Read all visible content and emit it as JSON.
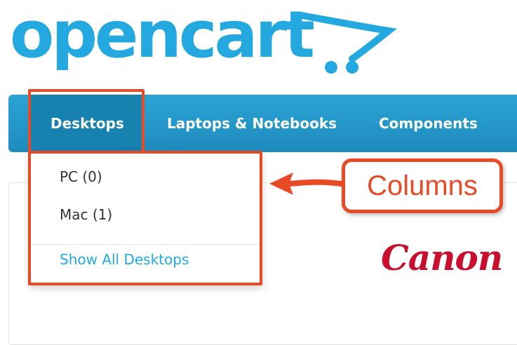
{
  "logo": {
    "text": "opencart"
  },
  "nav": {
    "items": [
      {
        "label": "Desktops"
      },
      {
        "label": "Laptops & Notebooks"
      },
      {
        "label": "Components"
      }
    ]
  },
  "dropdown": {
    "items": [
      {
        "label": "PC (0)"
      },
      {
        "label": "Mac (1)"
      }
    ],
    "show_all": "Show All Desktops"
  },
  "annotation": {
    "label": "Columns"
  },
  "brand": {
    "text": "Canon"
  },
  "colors": {
    "brand_blue": "#23a8e0",
    "nav_bg": "#1e8cbd",
    "highlight": "#e84a26",
    "canon_red": "#c8102e"
  }
}
